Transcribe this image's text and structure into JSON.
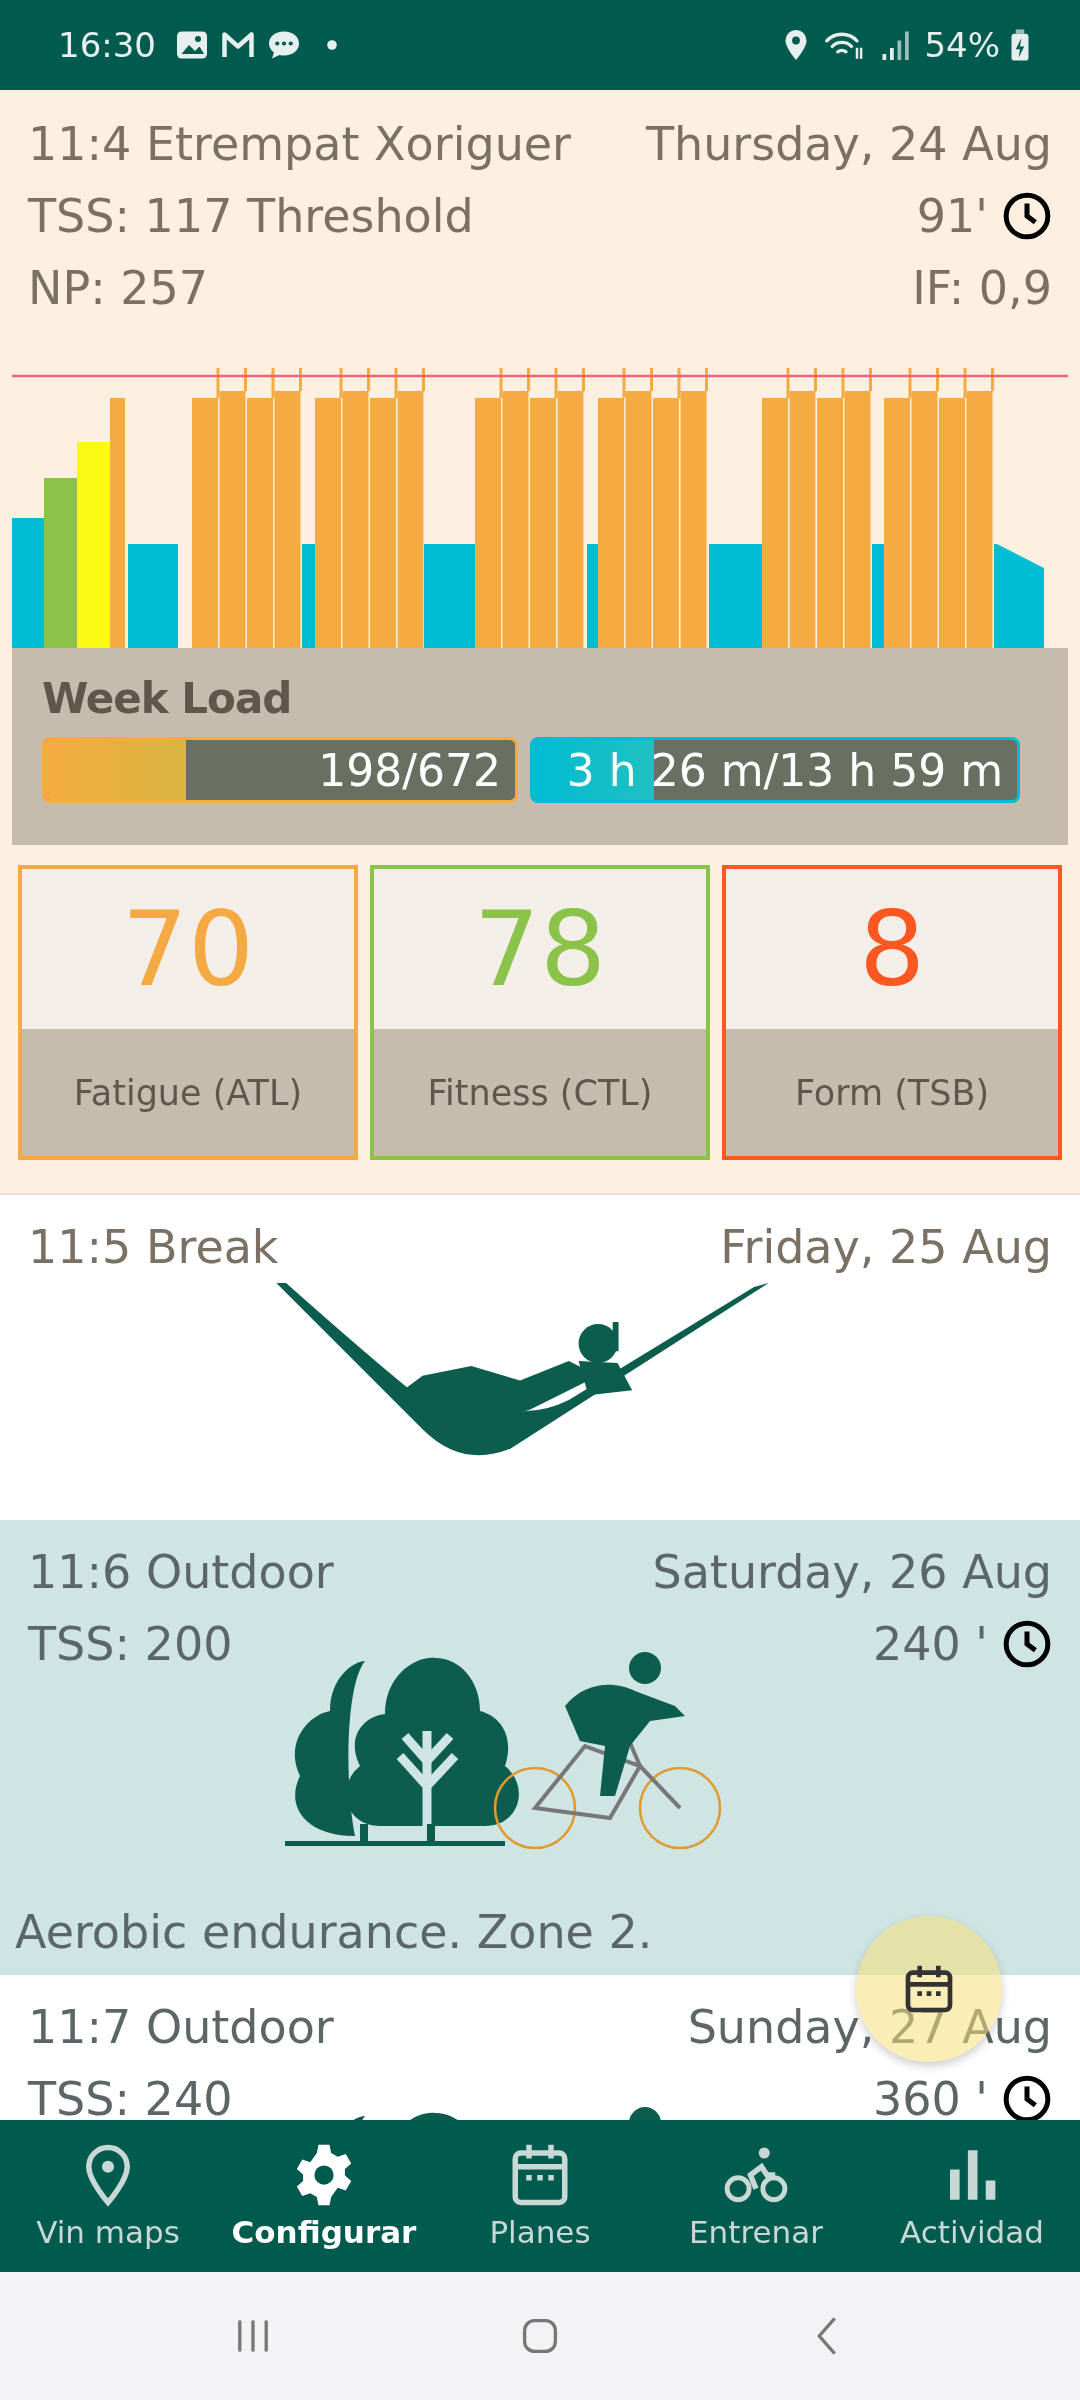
{
  "status_bar": {
    "time": "16:30",
    "battery": "54%"
  },
  "today": {
    "title": "11:4 Etrempat Xoriguer",
    "date": "Thursday, 24 Aug",
    "tss": "TSS: 117 Threshold",
    "duration": "91'",
    "np": "NP: 257",
    "intensity": "IF: 0,9",
    "week_load": {
      "label": "Week Load",
      "load": {
        "reading": "198/672",
        "level": 0.3
      },
      "time": {
        "reading": "3 h 26 m/13 h 59 m",
        "level": 0.25
      }
    },
    "metrics": [
      {
        "value": "70",
        "label": "Fatigue (ATL)",
        "color": "#f5a943"
      },
      {
        "value": "78",
        "label": "Fitness (CTL)",
        "color": "#8bc34a"
      },
      {
        "value": "8",
        "label": "Form (TSB)",
        "color": "#ff5722"
      }
    ]
  },
  "workouts": [
    {
      "kind": "break",
      "title": "11:5 Break",
      "date": "Friday, 25 Aug",
      "color": "#ffffff"
    },
    {
      "kind": "outdoor",
      "title": "11:6 Outdoor",
      "date": "Saturday, 26 Aug",
      "tss": "TSS: 200",
      "duration": "240 '",
      "note": "Aerobic endurance. Zone 2.",
      "color": "#cfe5e3"
    },
    {
      "kind": "outdoor",
      "title": "11:7 Outdoor",
      "date": "Sunday, 27 Aug",
      "tss": "TSS: 240",
      "duration": "360 '",
      "color": "#ffffff"
    }
  ],
  "nav": [
    {
      "label": "Vin maps",
      "kind": "pin",
      "selected": false
    },
    {
      "label": "Configurar",
      "kind": "gear",
      "selected": true
    },
    {
      "label": "Planes",
      "kind": "calendar",
      "selected": false
    },
    {
      "label": "Entrenar",
      "kind": "bike",
      "selected": false
    },
    {
      "label": "Actividad",
      "kind": "bars",
      "selected": false
    }
  ]
}
